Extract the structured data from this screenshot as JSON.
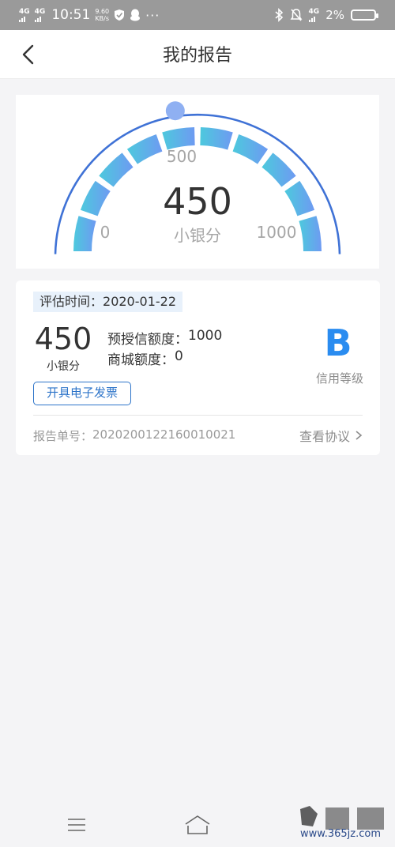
{
  "status_bar": {
    "net1": "4G",
    "net2": "4G",
    "time": "10:51",
    "speed_value": "9.60",
    "speed_unit": "KB/s",
    "more": "···",
    "net3": "4G",
    "battery_pct": "2%"
  },
  "nav": {
    "title": "我的报告"
  },
  "gauge": {
    "min_label": "0",
    "mid_label": "500",
    "max_label": "1000",
    "score": "450",
    "score_label": "小银分",
    "min": 0,
    "max": 1000,
    "value": 450,
    "colors": {
      "start": "#4dc9dd",
      "end": "#6e9af2",
      "outer_arc": "#3f72d6",
      "knob": "#8fb0f2"
    }
  },
  "report": {
    "eval_label": "评估时间：",
    "eval_date": "2020-01-22",
    "score": "450",
    "score_label": "小银分",
    "pre_credit_label": "预授信额度：",
    "pre_credit_value": "1000",
    "mall_label": "商城额度：",
    "mall_value": "0",
    "grade": "B",
    "grade_label": "信用等级",
    "invoice_button": "开具电子发票",
    "report_no_label": "报告单号：",
    "report_no_value": "2020200122160010021",
    "agreement_link": "查看协议"
  },
  "bottom_nav": {
    "menu_icon": "menu-icon",
    "home_icon": "home-icon"
  },
  "watermark": {
    "text": "www.365jz.com"
  }
}
